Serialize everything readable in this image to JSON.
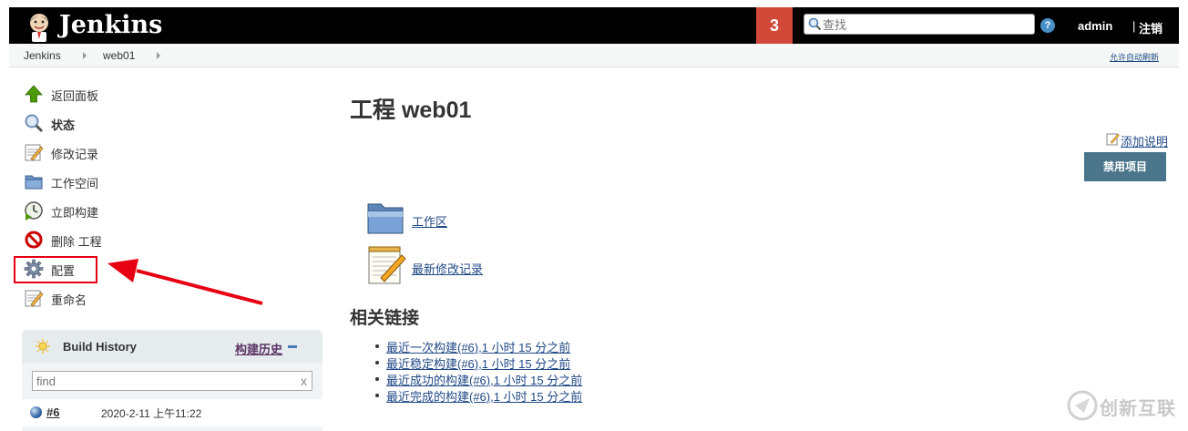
{
  "header": {
    "brand": "Jenkins",
    "notification_count": "3",
    "search_placeholder": "查找",
    "help": "?",
    "user": "admin",
    "logout_sep": "|",
    "logout": "注销",
    "accent_color": "#d24939"
  },
  "breadcrumb": {
    "items": [
      "Jenkins",
      "web01"
    ],
    "auto_refresh": "允许自动刷新"
  },
  "sidebar": {
    "items": [
      {
        "label": "返回面板",
        "icon": "up-arrow-icon"
      },
      {
        "label": "状态",
        "icon": "magnifier-icon"
      },
      {
        "label": "修改记录",
        "icon": "notepad-icon"
      },
      {
        "label": "工作空间",
        "icon": "folder-icon"
      },
      {
        "label": "立即构建",
        "icon": "clock-icon"
      },
      {
        "label": "删除 工程",
        "icon": "no-entry-icon"
      },
      {
        "label": "配置",
        "icon": "gear-icon"
      },
      {
        "label": "重命名",
        "icon": "notepad-icon"
      }
    ]
  },
  "build_history": {
    "title": "Build History",
    "trend_link": "构建历史",
    "filter_placeholder": "find",
    "clear": "x",
    "builds": [
      {
        "number": "#6",
        "date": "2020-2-11 上午11:22"
      }
    ]
  },
  "main": {
    "title": "工程 web01",
    "add_description": "添加说明",
    "disable_button": "禁用项目",
    "workspace_link": "工作区",
    "changes_link": "最新修改记录",
    "permalinks_title": "相关链接",
    "permalinks": [
      "最近一次构建(#6),1 小时 15 分之前",
      "最近稳定构建(#6),1 小时 15 分之前",
      "最近成功的构建(#6),1 小时 15 分之前",
      "最近完成的构建(#6),1 小时 15 分之前"
    ]
  },
  "watermark": {
    "text": "创新互联"
  }
}
